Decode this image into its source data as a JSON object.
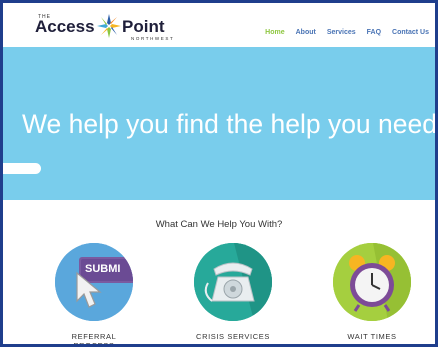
{
  "logo": {
    "the": "THE",
    "word1": "Access",
    "word2": "Point",
    "sub": "NORTHWEST"
  },
  "nav": {
    "items": [
      "Home",
      "About",
      "Services",
      "FAQ",
      "Contact Us"
    ],
    "active": "Home"
  },
  "hero": {
    "headline": "We help you find the help you need"
  },
  "services": {
    "title": "What Can We Help You With?",
    "items": [
      {
        "label": "REFERRAL PROCESS",
        "icon": "submit-button-cursor-icon",
        "badge": "SUBMI"
      },
      {
        "label": "CRISIS SERVICES",
        "icon": "telephone-icon"
      },
      {
        "label": "WAIT TIMES",
        "icon": "alarm-clock-icon"
      }
    ]
  },
  "colors": {
    "border": "#1f3e8c",
    "hero": "#79cdec",
    "nav_link": "#4a74b5",
    "nav_active": "#8dc63f"
  }
}
